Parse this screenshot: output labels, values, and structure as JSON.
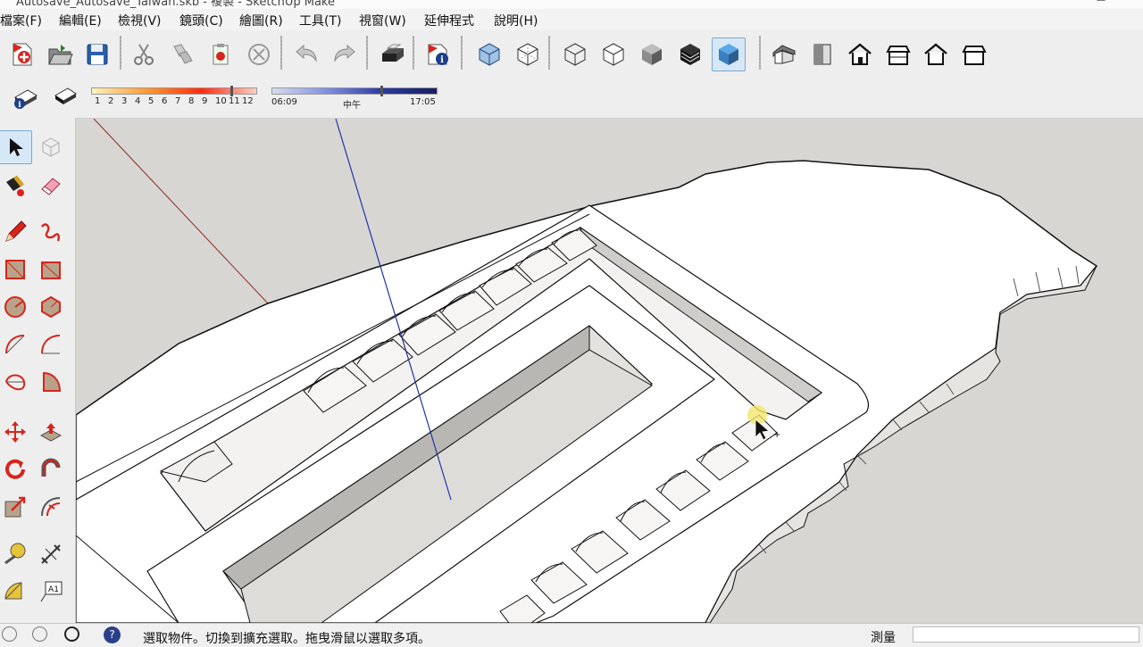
{
  "window": {
    "title": "Autosave_Autosave_Taiwan.skb - 複製 - SketchUp Make",
    "controls": [
      "–",
      "☐",
      "✕"
    ]
  },
  "menu": [
    {
      "label": "檔案(F)"
    },
    {
      "label": "編輯(E)"
    },
    {
      "label": "檢視(V)"
    },
    {
      "label": "鏡頭(C)"
    },
    {
      "label": "繪圖(R)"
    },
    {
      "label": "工具(T)"
    },
    {
      "label": "視窗(W)"
    },
    {
      "label": "延伸程式"
    },
    {
      "label": "說明(H)"
    }
  ],
  "toolbar_main": {
    "buttons": [
      "new",
      "open",
      "save",
      "cut",
      "copy",
      "paste",
      "erase",
      "undo",
      "redo",
      "print",
      "model-info",
      "xray",
      "back-edges",
      "wireframe",
      "hidden-line",
      "shaded",
      "shaded-with-textures",
      "monochrome",
      "iso-view",
      "top-view",
      "front-view",
      "right-view",
      "back-view",
      "left-view"
    ],
    "pressed": "monochrome"
  },
  "shadow_toolbar": {
    "month_ticks": [
      "1",
      "2",
      "3",
      "4",
      "5",
      "6",
      "7",
      "8",
      "9",
      "10",
      "11",
      "12"
    ],
    "time_start": "06:09",
    "time_mid": "中午",
    "time_end": "17:05",
    "month_gradient": [
      "#fff3c0",
      "#ff9a30",
      "#ff2a10",
      "#ffcfc0"
    ],
    "time_gradient": [
      "#d8dcef",
      "#7f8fe0",
      "#2a3aa0",
      "#1a1f60"
    ]
  },
  "left_tools": [
    "select",
    "make-component",
    "paint-bucket",
    "eraser",
    "line",
    "freehand",
    "rectangle",
    "rotated-rectangle",
    "circle",
    "polygon",
    "arc",
    "two-point-arc",
    "three-point-arc",
    "pie",
    "move",
    "push-pull",
    "rotate",
    "follow-me",
    "scale",
    "offset",
    "tape-measure",
    "dimension",
    "protractor",
    "text"
  ],
  "status": {
    "text": "選取物件。切換到擴充選取。拖曳滑鼠以選取多項。",
    "measure_label": "測量",
    "measure_value": ""
  },
  "colors": {
    "viewport_bg": "#d8d6d3",
    "model_face": "#ffffff",
    "axis_blue": "#2233aa",
    "axis_red": "#8a2a20"
  }
}
